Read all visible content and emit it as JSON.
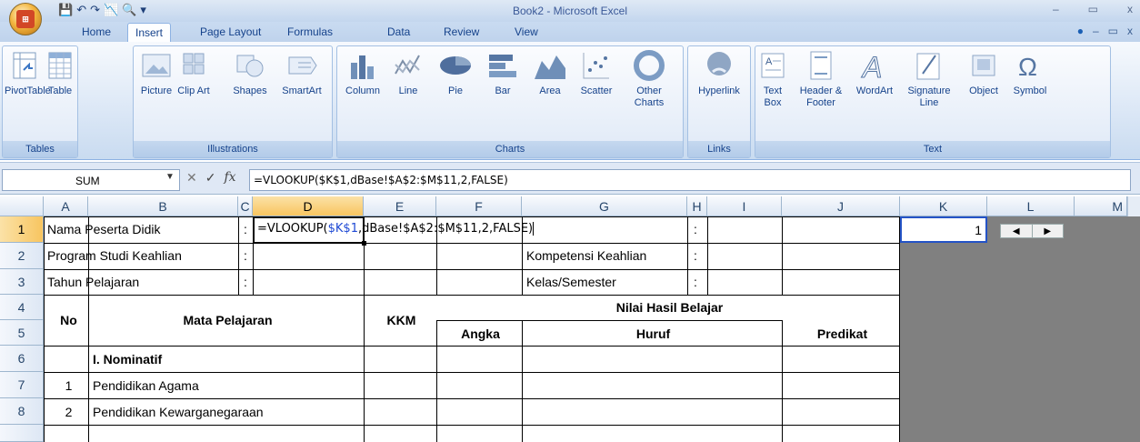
{
  "window": {
    "title": "Book2 - Microsoft Excel",
    "minimize": "–",
    "restore": "▭",
    "close": "x"
  },
  "tabs": [
    "Home",
    "Insert",
    "Page Layout",
    "Formulas",
    "Data",
    "Review",
    "View"
  ],
  "active_tab": "Insert",
  "ribbon": {
    "tables": {
      "label": "Tables",
      "buttons": [
        "PivotTable",
        "Table"
      ]
    },
    "illustrations": {
      "label": "Illustrations",
      "buttons": [
        "Picture",
        "Clip Art",
        "Shapes",
        "SmartArt"
      ]
    },
    "charts": {
      "label": "Charts",
      "buttons": [
        "Column",
        "Line",
        "Pie",
        "Bar",
        "Area",
        "Scatter",
        "Other Charts"
      ]
    },
    "links": {
      "label": "Links",
      "buttons": [
        "Hyperlink"
      ]
    },
    "text": {
      "label": "Text",
      "buttons": [
        "Text Box",
        "Header & Footer",
        "WordArt",
        "Signature Line",
        "Object",
        "Symbol"
      ]
    }
  },
  "formula_bar": {
    "name_box": "SUM",
    "cancel": "✕",
    "enter": "✓",
    "fx": "fx",
    "formula": "=VLOOKUP($K$1,dBase!$A$2:$M$11,2,FALSE)"
  },
  "columns": [
    "A",
    "B",
    "C",
    "D",
    "E",
    "F",
    "G",
    "H",
    "I",
    "J",
    "K",
    "L",
    "M"
  ],
  "rows": [
    "1",
    "2",
    "3",
    "4",
    "5",
    "6",
    "7",
    "8"
  ],
  "cells": {
    "a1": "Nama Peserta Didik",
    "c1": ":",
    "d1_prefix": "=VLOOKUP(",
    "d1_ref": "$K$1",
    "d1_suffix": ",dBase!$A$2:$M$11,2,FALSE)",
    "h1": ":",
    "a2": "Program Studi Keahlian",
    "c2": ":",
    "g2": "Kompetensi Keahlian",
    "h2": ":",
    "a3": "Tahun Pelajaran",
    "c3": ":",
    "g3": "Kelas/Semester",
    "h3": ":",
    "no": "No",
    "mapel": "Mata Pelajaran",
    "kkm": "KKM",
    "nilai": "Nilai Hasil Belajar",
    "angka": "Angka",
    "huruf": "Huruf",
    "predikat": "Predikat",
    "b6": "I. Nominatif",
    "a7": "1",
    "b7": "Pendidikan Agama",
    "a8": "2",
    "b8": "Pendidikan Kewarganegaraan",
    "k1": "1"
  },
  "spinner": {
    "left": "◀",
    "right": "▶"
  }
}
